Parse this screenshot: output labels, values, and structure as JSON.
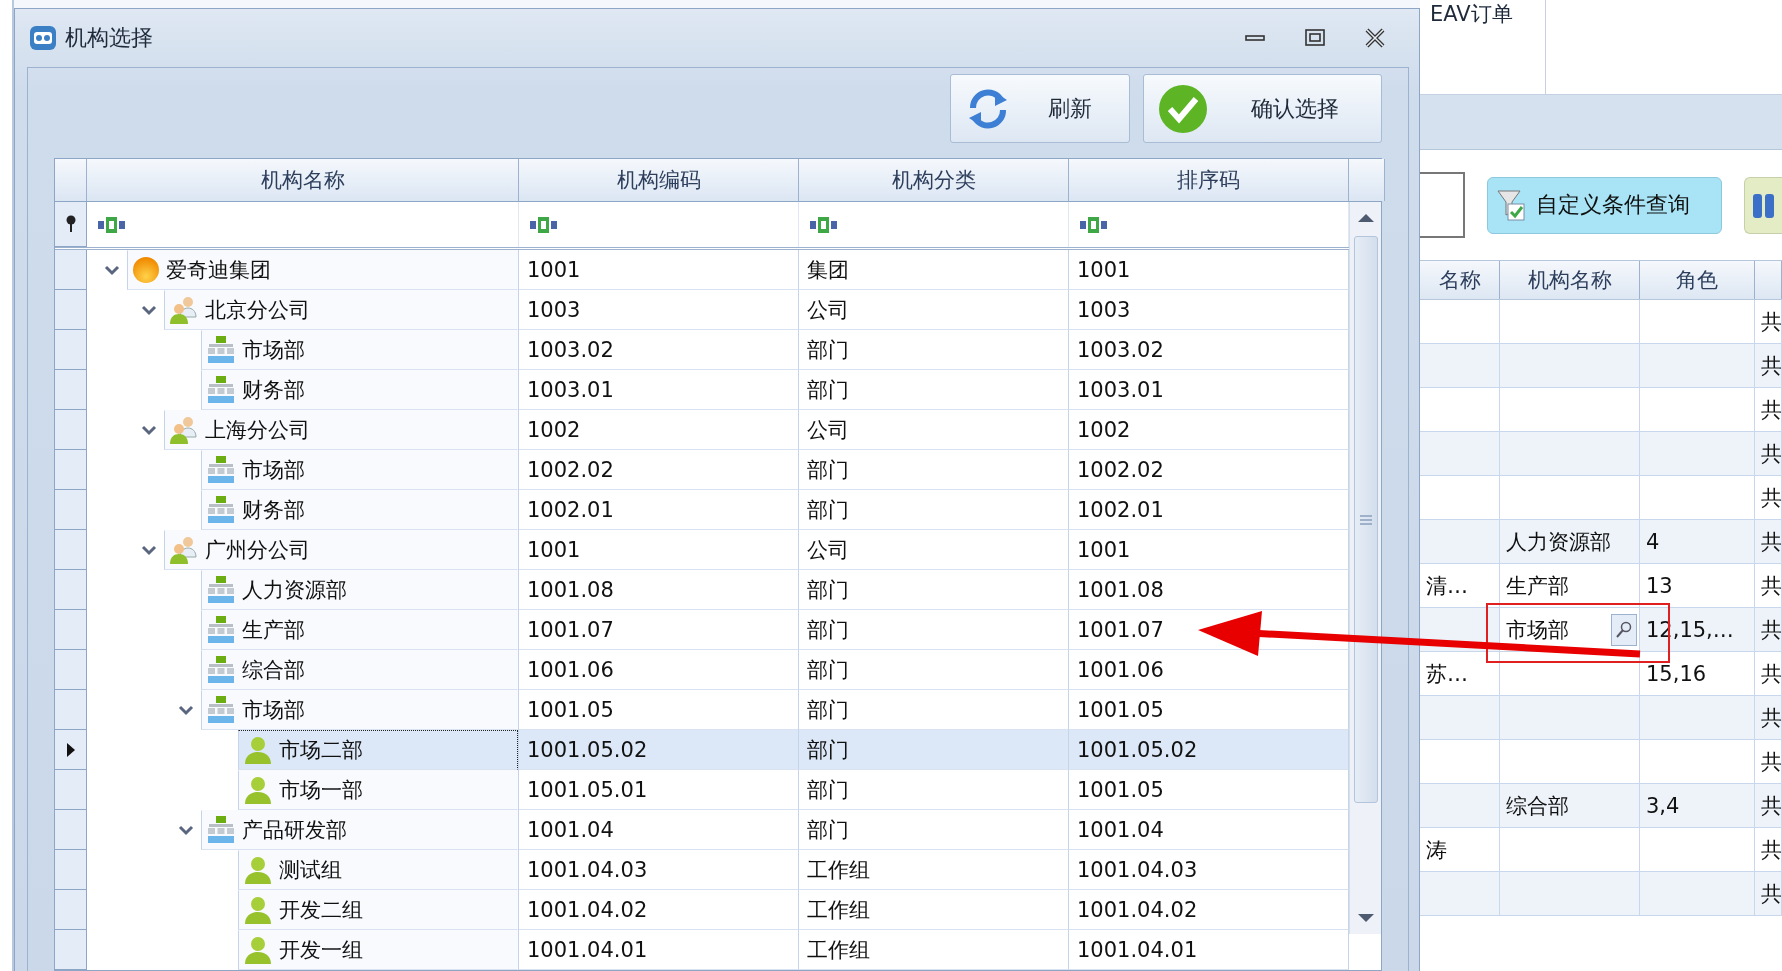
{
  "dialog": {
    "title": "机构选择",
    "buttons": [
      {
        "label": "刷新",
        "kind": "refresh"
      },
      {
        "label": "确认选择",
        "kind": "confirm"
      }
    ],
    "columns": [
      "机构名称",
      "机构编码",
      "机构分类",
      "排序码"
    ],
    "tree": [
      {
        "name": "爱奇迪集团",
        "code": "1001",
        "category": "集团",
        "sort": "1001",
        "kind": "group",
        "expanded": true,
        "selected": false,
        "children": [
          {
            "name": "北京分公司",
            "code": "1003",
            "category": "公司",
            "sort": "1003",
            "kind": "company",
            "expanded": true,
            "selected": false,
            "children": [
              {
                "name": "市场部",
                "code": "1003.02",
                "category": "部门",
                "sort": "1003.02",
                "kind": "department",
                "selected": false
              },
              {
                "name": "财务部",
                "code": "1003.01",
                "category": "部门",
                "sort": "1003.01",
                "kind": "department",
                "selected": false
              }
            ]
          },
          {
            "name": "上海分公司",
            "code": "1002",
            "category": "公司",
            "sort": "1002",
            "kind": "company",
            "expanded": true,
            "selected": false,
            "children": [
              {
                "name": "市场部",
                "code": "1002.02",
                "category": "部门",
                "sort": "1002.02",
                "kind": "department",
                "selected": false
              },
              {
                "name": "财务部",
                "code": "1002.01",
                "category": "部门",
                "sort": "1002.01",
                "kind": "department",
                "selected": false
              }
            ]
          },
          {
            "name": "广州分公司",
            "code": "1001",
            "category": "公司",
            "sort": "1001",
            "kind": "company",
            "expanded": true,
            "selected": false,
            "children": [
              {
                "name": "人力资源部",
                "code": "1001.08",
                "category": "部门",
                "sort": "1001.08",
                "kind": "department",
                "selected": false
              },
              {
                "name": "生产部",
                "code": "1001.07",
                "category": "部门",
                "sort": "1001.07",
                "kind": "department",
                "selected": false
              },
              {
                "name": "综合部",
                "code": "1001.06",
                "category": "部门",
                "sort": "1001.06",
                "kind": "department",
                "selected": false
              },
              {
                "name": "市场部",
                "code": "1001.05",
                "category": "部门",
                "sort": "1001.05",
                "kind": "department",
                "expanded": true,
                "selected": false,
                "children": [
                  {
                    "name": "市场二部",
                    "code": "1001.05.02",
                    "category": "部门",
                    "sort": "1001.05.02",
                    "kind": "team",
                    "selected": true
                  },
                  {
                    "name": "市场一部",
                    "code": "1001.05.01",
                    "category": "部门",
                    "sort": "1001.05",
                    "kind": "team",
                    "selected": false
                  }
                ]
              },
              {
                "name": "产品研发部",
                "code": "1001.04",
                "category": "部门",
                "sort": "1001.04",
                "kind": "department",
                "expanded": true,
                "selected": false,
                "children": [
                  {
                    "name": "测试组",
                    "code": "1001.04.03",
                    "category": "工作组",
                    "sort": "1001.04.03",
                    "kind": "team",
                    "selected": false
                  },
                  {
                    "name": "开发二组",
                    "code": "1001.04.02",
                    "category": "工作组",
                    "sort": "1001.04.02",
                    "kind": "team",
                    "selected": false
                  },
                  {
                    "name": "开发一组",
                    "code": "1001.04.01",
                    "category": "工作组",
                    "sort": "1001.04.01",
                    "kind": "team",
                    "selected": false
                  }
                ]
              }
            ]
          }
        ]
      }
    ]
  },
  "background_app": {
    "ribbon_tab": "EAV订单",
    "query_button": "自定义条件查询",
    "columns": [
      "名称",
      "机构名称",
      "角色"
    ],
    "rows": [
      {
        "column_4": "共",
        "editing": false
      },
      {
        "column_4": "共",
        "editing": false
      },
      {
        "column_4": "共",
        "editing": false
      },
      {
        "column_4": "共",
        "editing": false
      },
      {
        "column_4": "共",
        "editing": false
      },
      {
        "org": "人力资源部",
        "role": "4",
        "column_4": "共",
        "editing": false
      },
      {
        "name": "清…",
        "org": "生产部",
        "role": "13",
        "column_4": "共",
        "editing": false
      },
      {
        "org": "市场部",
        "role": "12,15,…",
        "column_4": "共",
        "editing": true
      },
      {
        "name": "苏…",
        "role": "15,16",
        "column_4": "共",
        "editing": false
      },
      {
        "column_4": "共",
        "editing": false
      },
      {
        "column_4": "共",
        "editing": false
      },
      {
        "org": "综合部",
        "role": "3,4",
        "column_4": "共",
        "editing": false
      },
      {
        "name": "涛",
        "column_4": "共",
        "editing": false
      },
      {
        "column_4": "共",
        "editing": false
      }
    ]
  }
}
